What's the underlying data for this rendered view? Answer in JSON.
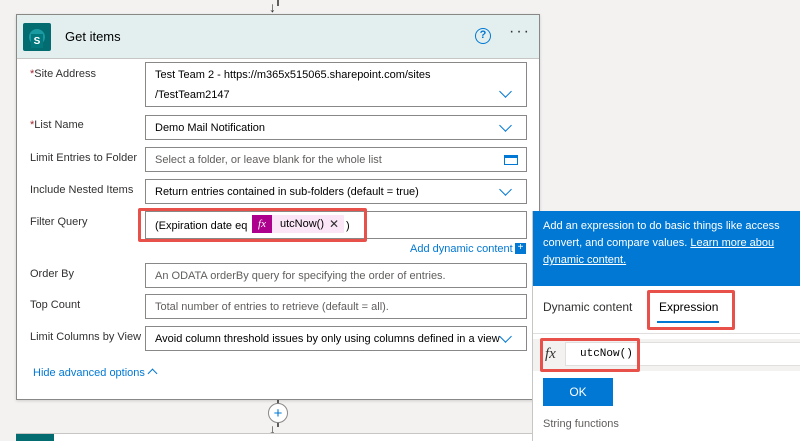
{
  "card": {
    "title": "Get items",
    "icon": "sharepoint-icon",
    "help_icon_glyph": "?",
    "more_glyph": "···"
  },
  "fields": {
    "site_address": {
      "label": "Site Address",
      "required_mark": "*",
      "value_line1": "Test Team 2 - https://m365x515065.sharepoint.com/sites",
      "value_line2": "/TestTeam2147"
    },
    "list_name": {
      "label": "List Name",
      "required_mark": "*",
      "value": "Demo Mail Notification"
    },
    "limit_folder": {
      "label": "Limit Entries to Folder",
      "placeholder": "Select a folder, or leave blank for the whole list"
    },
    "nested_items": {
      "label": "Include Nested Items",
      "value": "Return entries contained in sub-folders (default = true)"
    },
    "filter_query": {
      "label": "Filter Query",
      "prefix": "(Expiration date eq",
      "token_glyph": "fx",
      "token_label": "utcNow()",
      "token_remove": "✕",
      "suffix": ")"
    },
    "add_dynamic": "Add dynamic content",
    "add_dynamic_glyph": "+",
    "order_by": {
      "label": "Order By",
      "placeholder": "An ODATA orderBy query for specifying the order of entries."
    },
    "top_count": {
      "label": "Top Count",
      "placeholder": "Total number of entries to retrieve (default = all)."
    },
    "limit_columns": {
      "label": "Limit Columns by View",
      "value": "Avoid column threshold issues by only using columns defined in a view"
    },
    "hide_advanced": "Hide advanced options"
  },
  "flow": {
    "add_step_glyph": "+",
    "arrow_glyph": "↓"
  },
  "popup": {
    "banner_line1": "Add an expression to do basic things like access",
    "banner_line2_plain": "convert, and compare values.",
    "banner_line2_link": "Learn more abou",
    "banner_line3_link": "dynamic content.",
    "tab_dynamic": "Dynamic content",
    "tab_expression": "Expression",
    "active_tab": "Expression",
    "expr_glyph": "fx",
    "expr_value": "utcNow()",
    "ok_label": "OK",
    "section_label": "String functions"
  },
  "colors": {
    "accent": "#0078d4",
    "header_bg": "#e3efef",
    "sharepoint_teal": "#036c70",
    "token_magenta": "#ad008c",
    "highlight_red": "#e8514a"
  }
}
